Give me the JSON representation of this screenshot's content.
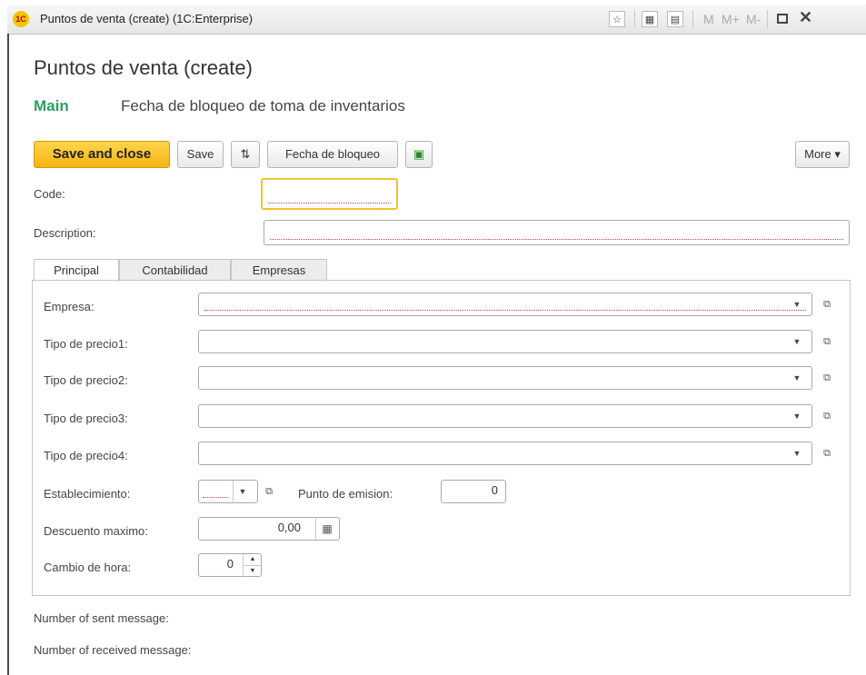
{
  "window": {
    "title": "Puntos de venta (create)  (1C:Enterprise)",
    "logo_text": "1C",
    "m_labels": [
      "M",
      "M+",
      "M-"
    ]
  },
  "page": {
    "title": "Puntos de venta (create)",
    "nav": {
      "main": "Main",
      "link": "Fecha de bloqueo de toma de inventarios"
    }
  },
  "toolbar": {
    "save_close": "Save and close",
    "save": "Save",
    "fecha": "Fecha de bloqueo",
    "more": "More ▾"
  },
  "form": {
    "code_label": "Code:",
    "code_value": "",
    "description_label": "Description:",
    "description_value": ""
  },
  "tabs": [
    "Principal",
    "Contabilidad",
    "Empresas"
  ],
  "principal": {
    "empresa": {
      "label": "Empresa:",
      "value": ""
    },
    "tipo1": {
      "label": "Tipo de precio1:",
      "value": ""
    },
    "tipo2": {
      "label": "Tipo de precio2:",
      "value": ""
    },
    "tipo3": {
      "label": "Tipo de precio3:",
      "value": ""
    },
    "tipo4": {
      "label": "Tipo de precio4:",
      "value": ""
    },
    "establecimiento": {
      "label": "Establecimiento:",
      "value": ""
    },
    "punto_emision": {
      "label": "Punto de emision:",
      "value": "0"
    },
    "descuento": {
      "label": "Descuento maximo:",
      "value": "0,00"
    },
    "cambio_hora": {
      "label": "Cambio de hora:",
      "value": "0"
    }
  },
  "footer": {
    "sent": "Number of sent message:",
    "received": "Number of received message:"
  },
  "colors": {
    "primary_button": "#f3b414",
    "main_nav": "#2e9e5e",
    "required_marker": "#d04040"
  }
}
